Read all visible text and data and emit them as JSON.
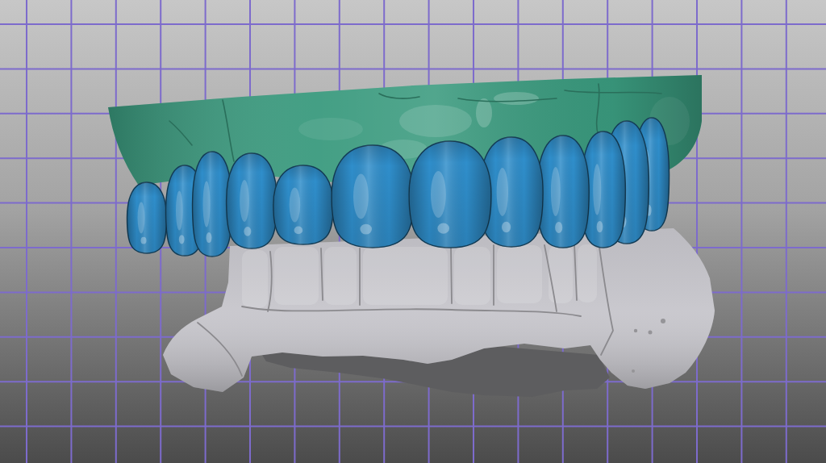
{
  "scene": {
    "model_parts": [
      {
        "kind": "upper-gingiva",
        "color": "#3a9a7e"
      },
      {
        "kind": "crowns",
        "color": "#2f8ecb"
      },
      {
        "kind": "lower-arch",
        "color": "#c6c5cb"
      }
    ]
  }
}
